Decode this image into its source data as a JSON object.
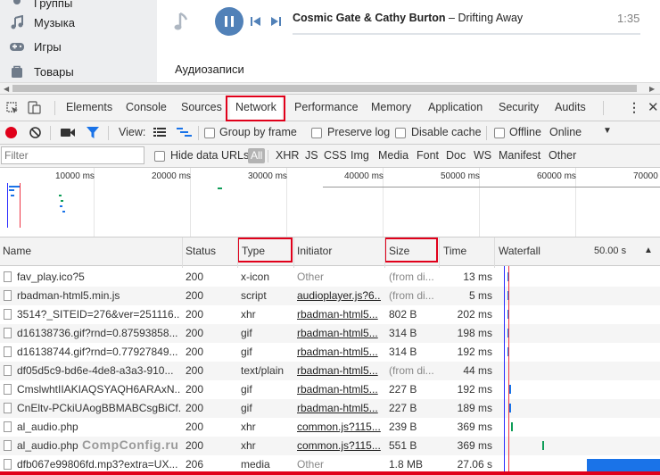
{
  "vk": {
    "menu": [
      {
        "label": "Группы",
        "icon": "groups-icon"
      },
      {
        "label": "Музыка",
        "icon": "music-icon"
      },
      {
        "label": "Игры",
        "icon": "games-icon"
      },
      {
        "label": "Товары",
        "icon": "goods-icon"
      }
    ],
    "player": {
      "artist": "Cosmic Gate & Cathy Burton",
      "separator": " – ",
      "title": "Drifting Away",
      "time": "1:35"
    },
    "section_title": "Аудиозаписи"
  },
  "devtools": {
    "tabs": [
      "Elements",
      "Console",
      "Sources",
      "Network",
      "Performance",
      "Memory",
      "Application",
      "Security",
      "Audits"
    ],
    "active_tab": "Network",
    "toolbar": {
      "view_label": "View:",
      "group_by_frame": "Group by frame",
      "preserve_log": "Preserve log",
      "disable_cache": "Disable cache",
      "offline": "Offline",
      "throttle": "Online"
    },
    "filter": {
      "placeholder": "Filter",
      "hide_data_urls": "Hide data URLs",
      "types": [
        "All",
        "XHR",
        "JS",
        "CSS",
        "Img",
        "Media",
        "Font",
        "Doc",
        "WS",
        "Manifest",
        "Other"
      ]
    },
    "overview_ticks": [
      "10000 ms",
      "20000 ms",
      "30000 ms",
      "40000 ms",
      "50000 ms",
      "60000 ms",
      "70000"
    ],
    "columns": [
      "Name",
      "Status",
      "Type",
      "Initiator",
      "Size",
      "Time",
      "Waterfall"
    ],
    "waterfall_scale": "50.00 s",
    "rows": [
      {
        "name": "fav_play.ico?5",
        "status": "200",
        "type": "x-icon",
        "initiator": "Other",
        "initiator_link": false,
        "size": "(from di...",
        "size_grey": true,
        "time": "13 ms",
        "wf": 0.07,
        "wf_color": "#1a73e8"
      },
      {
        "name": "rbadman-html5.min.js",
        "status": "200",
        "type": "script",
        "initiator": "audioplayer.js?6...",
        "initiator_link": true,
        "size": "(from di...",
        "size_grey": true,
        "time": "5 ms",
        "wf": 0.07,
        "wf_color": "#1a73e8"
      },
      {
        "name": "3514?_SITEID=276&ver=251116...",
        "status": "200",
        "type": "xhr",
        "initiator": "rbadman-html5...",
        "initiator_link": true,
        "size": "802 B",
        "size_grey": false,
        "time": "202 ms",
        "wf": 0.07,
        "wf_color": "#1a73e8"
      },
      {
        "name": "d16138736.gif?rnd=0.87593858...",
        "status": "200",
        "type": "gif",
        "initiator": "rbadman-html5...",
        "initiator_link": true,
        "size": "314 B",
        "size_grey": false,
        "time": "198 ms",
        "wf": 0.07,
        "wf_color": "#1a73e8"
      },
      {
        "name": "d16138744.gif?rnd=0.77927849...",
        "status": "200",
        "type": "gif",
        "initiator": "rbadman-html5...",
        "initiator_link": true,
        "size": "314 B",
        "size_grey": false,
        "time": "192 ms",
        "wf": 0.07,
        "wf_color": "#1a73e8"
      },
      {
        "name": "df05d5c9-bd6e-4de8-a3a3-910...",
        "status": "200",
        "type": "text/plain",
        "initiator": "rbadman-html5...",
        "initiator_link": true,
        "size": "(from di...",
        "size_grey": true,
        "time": "44 ms",
        "wf": null,
        "wf_color": "#1a73e8"
      },
      {
        "name": "CmslwhtIIAKIAQSYAQH6ARAxN...",
        "status": "200",
        "type": "gif",
        "initiator": "rbadman-html5...",
        "initiator_link": true,
        "size": "227 B",
        "size_grey": false,
        "time": "192 ms",
        "wf": 0.08,
        "wf_color": "#1a73e8"
      },
      {
        "name": "CnEltv-PCkiUAogBBMABCsgBiCf...",
        "status": "200",
        "type": "gif",
        "initiator": "rbadman-html5...",
        "initiator_link": true,
        "size": "227 B",
        "size_grey": false,
        "time": "189 ms",
        "wf": 0.08,
        "wf_color": "#1a73e8"
      },
      {
        "name": "al_audio.php",
        "status": "200",
        "type": "xhr",
        "initiator": "common.js?115...",
        "initiator_link": true,
        "size": "239 B",
        "size_grey": false,
        "time": "369 ms",
        "wf": 0.09,
        "wf_color": "#0f9d58"
      },
      {
        "name": "al_audio.php",
        "status": "200",
        "type": "xhr",
        "initiator": "common.js?115...",
        "initiator_link": true,
        "size": "551 B",
        "size_grey": false,
        "time": "369 ms",
        "wf": 0.28,
        "wf_color": "#0f9d58"
      },
      {
        "name": "dfb067e99806fd.mp3?extra=UX...",
        "status": "206",
        "type": "media",
        "initiator": "Other",
        "initiator_link": false,
        "size": "1.8 MB",
        "size_grey": false,
        "time": "27.06 s",
        "wf": 0.42,
        "wf_color": "#1a73e8"
      }
    ]
  },
  "watermark": "CompConfig.ru"
}
